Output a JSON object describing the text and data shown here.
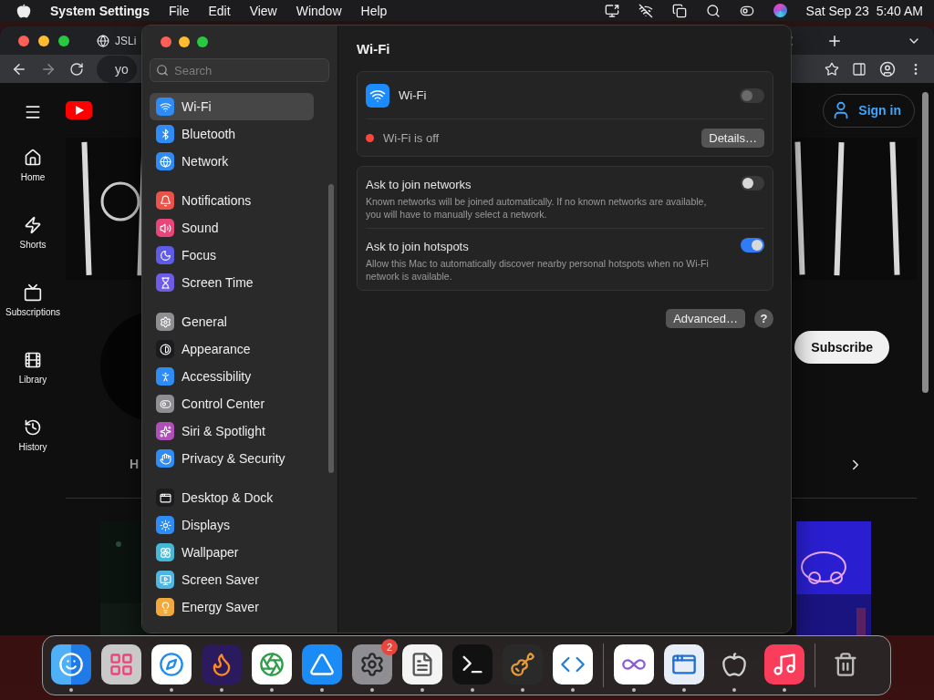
{
  "menu_bar": {
    "app_name": "System Settings",
    "menus": [
      "File",
      "Edit",
      "View",
      "Window",
      "Help"
    ],
    "clock": "Sat Sep 23  5:40 AM"
  },
  "browser": {
    "tab_title": "JSLi",
    "address": "yo",
    "nav": [
      {
        "label": "Home",
        "kind": "home"
      },
      {
        "label": "Shorts",
        "kind": "shorts"
      },
      {
        "label": "Subscriptions",
        "kind": "subscriptions"
      },
      {
        "label": "Library",
        "kind": "library"
      },
      {
        "label": "History",
        "kind": "history"
      }
    ],
    "sign_in": "Sign in",
    "subscribe": "Subscribe",
    "partial_tab": "H"
  },
  "settings": {
    "search": {
      "placeholder": "Search"
    },
    "sidebar": [
      {
        "items": [
          {
            "label": "Wi-Fi",
            "kind": "wifi",
            "color": "#2f8cf5",
            "selected": true
          },
          {
            "label": "Bluetooth",
            "kind": "bluetooth",
            "color": "#2f8cf5",
            "selected": false
          },
          {
            "label": "Network",
            "kind": "network",
            "color": "#2f8cf5",
            "selected": false
          }
        ]
      },
      {
        "items": [
          {
            "label": "Notifications",
            "kind": "notifications",
            "color": "#e9534a",
            "selected": false
          },
          {
            "label": "Sound",
            "kind": "sound",
            "color": "#e8457a",
            "selected": false
          },
          {
            "label": "Focus",
            "kind": "focus",
            "color": "#5e5ce6",
            "selected": false
          },
          {
            "label": "Screen Time",
            "kind": "screentime",
            "color": "#6e5ce6",
            "selected": false
          }
        ]
      },
      {
        "items": [
          {
            "label": "General",
            "kind": "general",
            "color": "#8e8e93",
            "selected": false
          },
          {
            "label": "Appearance",
            "kind": "appearance",
            "color": "#1c1c1e",
            "selected": false
          },
          {
            "label": "Accessibility",
            "kind": "accessibility",
            "color": "#2f8cf5",
            "selected": false
          },
          {
            "label": "Control Center",
            "kind": "controlcenter",
            "color": "#8e8e93",
            "selected": false
          },
          {
            "label": "Siri & Spotlight",
            "kind": "siri",
            "color": "#b04fb8",
            "selected": false
          },
          {
            "label": "Privacy & Security",
            "kind": "privacy",
            "color": "#2f8cf5",
            "selected": false
          }
        ]
      },
      {
        "items": [
          {
            "label": "Desktop & Dock",
            "kind": "dock",
            "color": "#1c1c1e",
            "selected": false
          },
          {
            "label": "Displays",
            "kind": "displays",
            "color": "#2f8cf5",
            "selected": false
          },
          {
            "label": "Wallpaper",
            "kind": "wallpaper",
            "color": "#45b8d8",
            "selected": false
          },
          {
            "label": "Screen Saver",
            "kind": "screensaver",
            "color": "#4fb6e0",
            "selected": false
          },
          {
            "label": "Energy Saver",
            "kind": "energy",
            "color": "#f2a93b",
            "selected": false
          }
        ]
      }
    ],
    "title": "Wi-Fi",
    "wifi": {
      "label": "Wi-Fi",
      "on": false,
      "status": "Wi-Fi is off",
      "details_button": "Details…"
    },
    "options": [
      {
        "title": "Ask to join networks",
        "description": "Known networks will be joined automatically. If no known networks are available, you will have to manually select a network.",
        "on": false
      },
      {
        "title": "Ask to join hotspots",
        "description": "Allow this Mac to automatically discover nearby personal hotspots when no Wi-Fi network is available.",
        "on": true
      }
    ],
    "advanced_button": "Advanced…",
    "help_button": "?"
  },
  "dock": [
    {
      "kind": "finder",
      "running": true
    },
    {
      "kind": "launchpad",
      "running": false
    },
    {
      "kind": "safari",
      "running": true
    },
    {
      "kind": "firefox",
      "running": true
    },
    {
      "kind": "chrome",
      "running": true
    },
    {
      "kind": "appstore",
      "running": true
    },
    {
      "kind": "settings",
      "running": true,
      "badge": "2"
    },
    {
      "kind": "textedit",
      "running": true
    },
    {
      "kind": "terminal",
      "running": true
    },
    {
      "kind": "garageband",
      "running": true
    },
    {
      "kind": "vscode",
      "running": true
    },
    {
      "kind": "separator"
    },
    {
      "kind": "visualstudio",
      "running": true
    },
    {
      "kind": "remote",
      "running": true
    },
    {
      "kind": "apple",
      "running": true
    },
    {
      "kind": "music",
      "running": true
    },
    {
      "kind": "separator"
    },
    {
      "kind": "trash",
      "running": false
    }
  ]
}
